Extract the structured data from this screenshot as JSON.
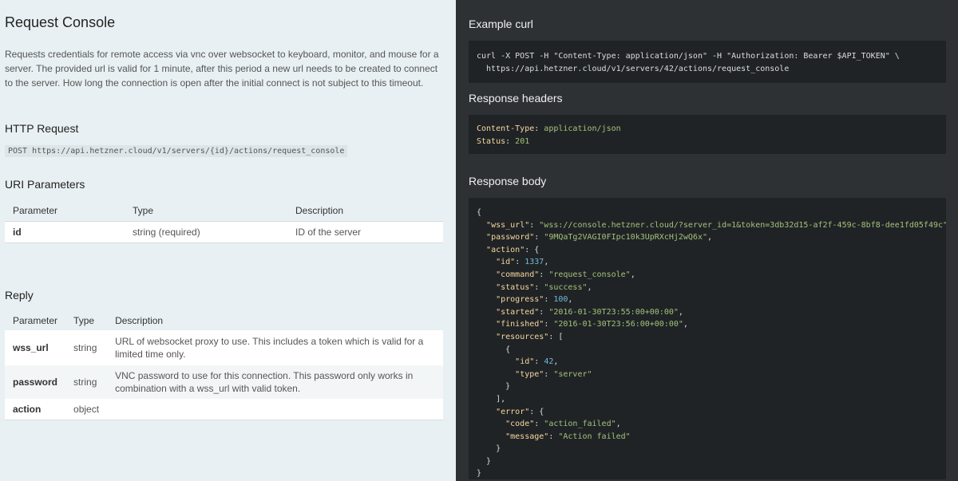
{
  "left": {
    "title": "Request Console",
    "description": "Requests credentials for remote access via vnc over websocket to keyboard, monitor, and mouse for a server. The provided url is valid for 1 minute, after this period a new url needs to be created to connect to the server. How long the connection is open after the initial connect is not subject to this timeout.",
    "http_request": {
      "heading": "HTTP Request",
      "endpoint": "POST https://api.hetzner.cloud/v1/servers/{id}/actions/request_console"
    },
    "uri_parameters": {
      "heading": "URI Parameters",
      "columns": [
        "Parameter",
        "Type",
        "Description"
      ],
      "rows": [
        {
          "name": "id",
          "type": "string (required)",
          "description": "ID of the server"
        }
      ]
    },
    "reply": {
      "heading": "Reply",
      "columns": [
        "Parameter",
        "Type",
        "Description"
      ],
      "rows": [
        {
          "name": "wss_url",
          "type": "string",
          "description": "URL of websocket proxy to use. This includes a token which is valid for a limited time only."
        },
        {
          "name": "password",
          "type": "string",
          "description": "VNC password to use for this connection. This password only works in combination with a wss_url with valid token."
        },
        {
          "name": "action",
          "type": "object",
          "description": ""
        }
      ]
    }
  },
  "right": {
    "curl": {
      "heading": "Example curl",
      "line1": "curl -X POST -H \"Content-Type: application/json\" -H \"Authorization: Bearer $API_TOKEN\" \\",
      "line2": "  https://api.hetzner.cloud/v1/servers/42/actions/request_console"
    },
    "headers": {
      "heading": "Response headers",
      "content_type_key": "Content-Type",
      "content_type_value": "application/json",
      "status_key": "Status",
      "status_value": "201"
    },
    "body": {
      "heading": "Response body",
      "wss_url": "\"wss://console.hetzner.cloud/?server_id=1&token=3db32d15-af2f-459c-8bf8-dee1fd05f49c\"",
      "password": "\"9MQaTg2VAGI0FIpc10k3UpRXcHj2wQ6x\"",
      "action_id": "1337",
      "command": "\"request_console\"",
      "status": "\"success\"",
      "progress": "100",
      "started": "\"2016-01-30T23:55:00+00:00\"",
      "finished": "\"2016-01-30T23:56:00+00:00\"",
      "resource_id": "42",
      "resource_type": "\"server\"",
      "error_code": "\"action_failed\"",
      "error_message": "\"Action failed\""
    }
  }
}
